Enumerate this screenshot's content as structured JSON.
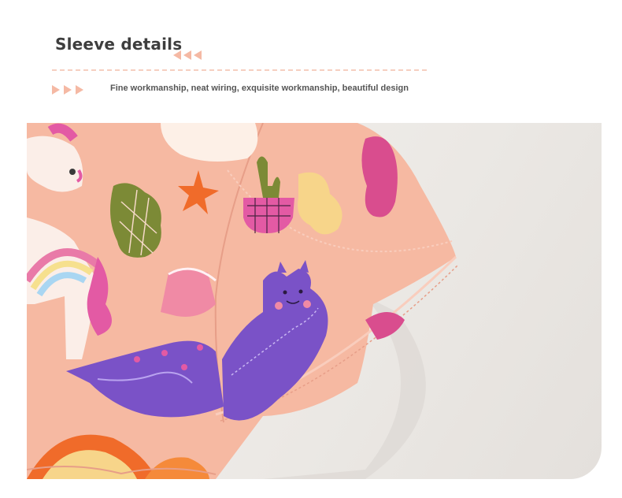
{
  "header": {
    "title": "Sleeve details",
    "subtitle": "Fine workmanship, neat wiring, exquisite workmanship, beautiful design"
  },
  "colors": {
    "accent": "#f5b9a4",
    "fabric": "#f6b9a2",
    "title_text": "#3e3e3e"
  }
}
